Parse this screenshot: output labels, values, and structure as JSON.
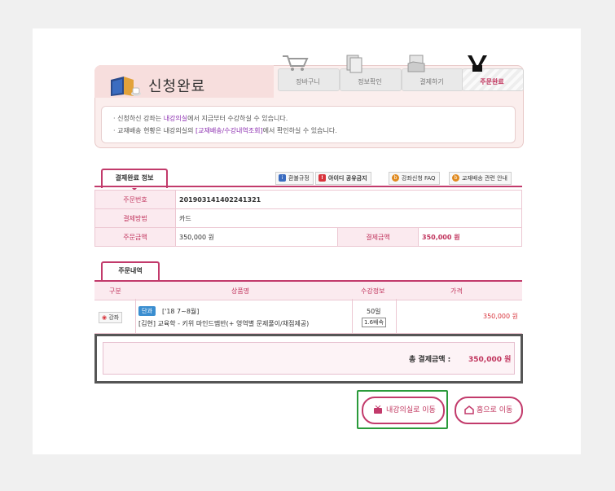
{
  "title": "신청완료",
  "steps": [
    {
      "label": "장바구니",
      "icon": "cart-icon"
    },
    {
      "label": "정보확인",
      "icon": "document-icon"
    },
    {
      "label": "결제하기",
      "icon": "hand-card-icon"
    },
    {
      "label": "주문완료",
      "icon": "hands-icon"
    }
  ],
  "notice": {
    "line1_a": "신청하신 강좌는 ",
    "line1_b": "내강의실",
    "line1_c": "에서 지금부터 수강하실 수 있습니다.",
    "line2_a": "교재배송 현황은 내강의실의 ",
    "line2_b": "[교재배송/수강내역조회]",
    "line2_c": "에서 확인하실 수 있습니다."
  },
  "payment_section": {
    "tab": "결제완료 정보",
    "buttons": [
      "환불규정",
      "아이디 공유금지",
      "강좌신청 FAQ",
      "교재배송 관련 안내"
    ],
    "order_no_label": "주문번호",
    "order_no": "201903141402241321",
    "method_label": "결제방법",
    "method": "카드",
    "amount_label": "주문금액",
    "amount": "350,000 원",
    "paid_label": "결제금액",
    "paid": "350,000 원"
  },
  "order_section": {
    "tab": "주문내역",
    "columns": [
      "구분",
      "상품명",
      "수강정보",
      "가격"
    ],
    "row": {
      "type": "강좌",
      "badge": "단과",
      "period": "['18 7~8월]",
      "name": "[김현] 교육학 - 키위 마인드맵반(+ 영역별 문제풀이/채점제공)",
      "days": "50일",
      "speed": "1.6배속",
      "price": "350,000 원"
    },
    "total_label": "총 결제금액 :",
    "total": "350,000 원"
  },
  "actions": {
    "classroom": "내강의실로 이동",
    "home": "홈으로 이동"
  },
  "colors": {
    "accent": "#c23a6b",
    "highlight": "#2a9a3a"
  }
}
